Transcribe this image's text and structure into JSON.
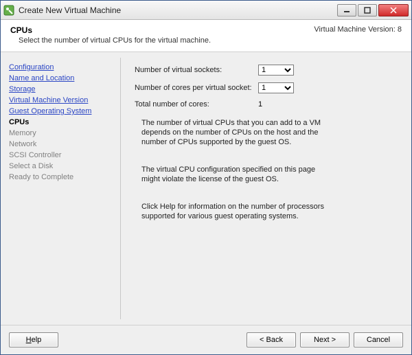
{
  "window": {
    "title": "Create New Virtual Machine"
  },
  "header": {
    "heading": "CPUs",
    "subheading": "Select the number of virtual CPUs for the virtual machine.",
    "version": "Virtual Machine Version: 8"
  },
  "sidebar": {
    "steps": [
      {
        "label": "Configuration",
        "state": "done"
      },
      {
        "label": "Name and Location",
        "state": "done"
      },
      {
        "label": "Storage",
        "state": "done"
      },
      {
        "label": "Virtual Machine Version",
        "state": "done"
      },
      {
        "label": "Guest Operating System",
        "state": "done"
      },
      {
        "label": "CPUs",
        "state": "current"
      },
      {
        "label": "Memory",
        "state": "future"
      },
      {
        "label": "Network",
        "state": "future"
      },
      {
        "label": "SCSI Controller",
        "state": "future"
      },
      {
        "label": "Select a Disk",
        "state": "future"
      },
      {
        "label": "Ready to Complete",
        "state": "future"
      }
    ]
  },
  "form": {
    "sockets_label": "Number of virtual sockets:",
    "sockets_value": "1",
    "cores_label": "Number of cores per virtual socket:",
    "cores_value": "1",
    "total_cores_label": "Total number of cores:",
    "total_cores_value": "1"
  },
  "info": {
    "p1": "The number of virtual CPUs that you can add to a VM depends on the number of CPUs on the host and the number of CPUs supported by the guest OS.",
    "p2": "The virtual CPU configuration specified on this page might violate the license of the guest OS.",
    "p3": "Click Help for information on the number of processors supported for various guest operating systems."
  },
  "footer": {
    "help": "Help",
    "back": "< Back",
    "next": "Next >",
    "cancel": "Cancel"
  }
}
